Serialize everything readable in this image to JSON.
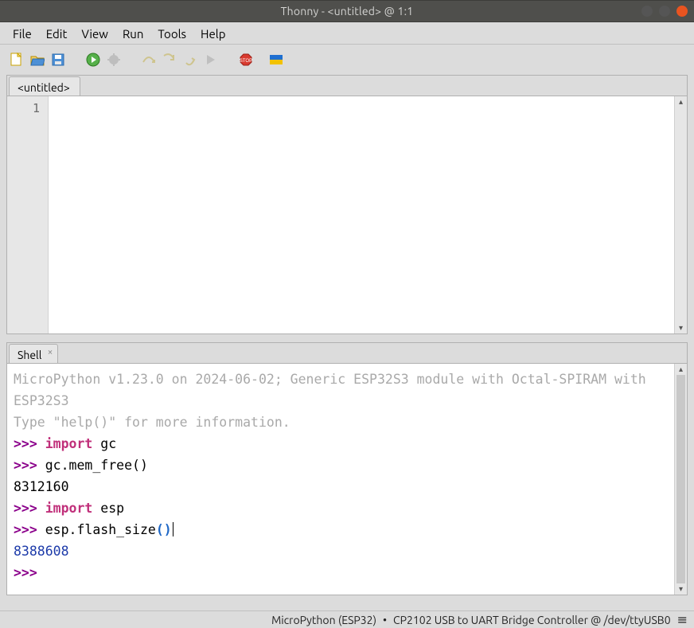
{
  "title": "Thonny - <untitled> @ 1:1",
  "menus": [
    "File",
    "Edit",
    "View",
    "Run",
    "Tools",
    "Help"
  ],
  "toolbar_icons": [
    "new-file-icon",
    "open-file-icon",
    "save-file-icon",
    "run-icon",
    "debug-icon",
    "step-over-icon",
    "step-into-icon",
    "step-out-icon",
    "resume-icon",
    "stop-icon",
    "flag-icon"
  ],
  "editor": {
    "tab_label": "<untitled>",
    "gutter_line": "1",
    "content": ""
  },
  "shell": {
    "tab_label": "Shell",
    "banner_line1": "MicroPython v1.23.0 on 2024-06-02; Generic ESP32S3 module with Octal-SPIRAM with ESP32S3",
    "banner_line2": "Type \"help()\" for more information.",
    "lines": [
      {
        "prompt": ">>> ",
        "kw": "import",
        "rest": " gc"
      },
      {
        "prompt": ">>> ",
        "text": "gc.mem_free()"
      }
    ],
    "output1": "8312160",
    "lines2": [
      {
        "prompt": ">>> ",
        "kw": "import",
        "rest": " esp"
      },
      {
        "prompt": ">>> ",
        "text_pre": "esp.flash_size",
        "paren": "()"
      }
    ],
    "output2": "8388608",
    "final_prompt": ">>> "
  },
  "status": {
    "backend": "MicroPython (ESP32)",
    "sep": "•",
    "port": "CP2102 USB to UART Bridge Controller @ /dev/ttyUSB0",
    "menu_glyph": "≡"
  }
}
